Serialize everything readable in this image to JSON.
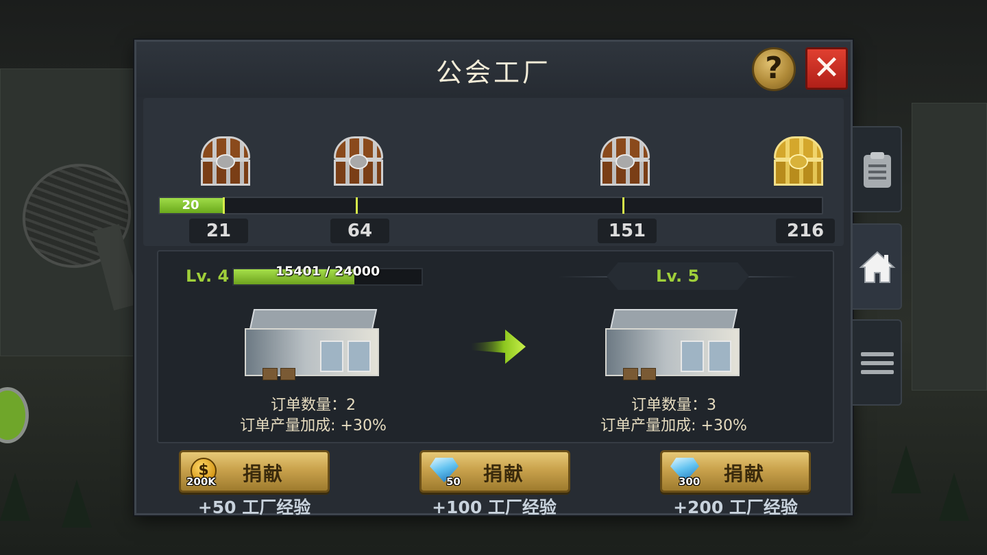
{
  "title": "公会工厂",
  "buttons": {
    "help_glyph": "?",
    "close_glyph": "✕"
  },
  "rewards": {
    "progress_value": "20",
    "progress_fraction": 0.095,
    "chests": [
      {
        "tier": "silver",
        "threshold": "21"
      },
      {
        "tier": "silver",
        "threshold": "64"
      },
      {
        "tier": "silver",
        "threshold": "151"
      },
      {
        "tier": "gold",
        "threshold": "216"
      }
    ]
  },
  "level": {
    "current_label": "Lv. 4",
    "next_label": "Lv. 5",
    "exp_text": "15401 / 24000",
    "exp_fraction": 0.642,
    "current_stats": {
      "orders": "订单数量：2",
      "bonus": "订单产量加成: +30%"
    },
    "next_stats": {
      "orders": "订单数量：3",
      "bonus": "订单产量加成: +30%"
    }
  },
  "donations": [
    {
      "label": "捐献",
      "currency_icon": "coin-icon",
      "coin_glyph": "$",
      "cost": "200K",
      "exp": "+50 工厂经验"
    },
    {
      "label": "捐献",
      "currency_icon": "diamond-icon",
      "cost": "50",
      "exp": "+100 工厂经验"
    },
    {
      "label": "捐献",
      "currency_icon": "diamond-icon",
      "cost": "300",
      "exp": "+200 工厂经验"
    }
  ],
  "side_tabs": [
    {
      "icon": "clipboard-icon",
      "active": false
    },
    {
      "icon": "home-icon",
      "active": true
    },
    {
      "icon": "menu-icon",
      "active": false
    }
  ],
  "colors": {
    "accent_green": "#9fcf3a",
    "gold_button": "#c9a24c",
    "close_red": "#c4271d"
  }
}
